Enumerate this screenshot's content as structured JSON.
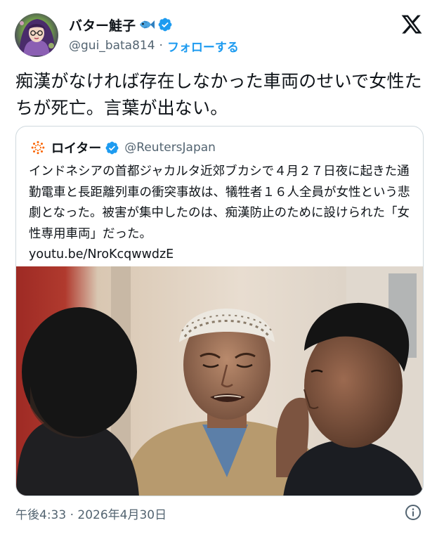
{
  "author": {
    "display_name": "バター鮭子",
    "name_icons": [
      "fish-icon",
      "verified-icon"
    ],
    "handle": "@gui_bata814",
    "separator": "·",
    "follow_label": "フォローする"
  },
  "platform_logo": "x-logo",
  "tweet": {
    "text": "痴漢がなければ存在しなかった車両のせいで女性たちが死亡。言葉が出ない。"
  },
  "quote": {
    "name": "ロイター",
    "handle": "@ReutersJapan",
    "text": "インドネシアの首都ジャカルタ近郊ブカシで４月２７日夜に起きた通勤電車と長距離列車の衝突事故は、犠牲者１６人全員が女性という悲劇となった。被害が集中したのは、痴漢防止のために設けられた「女性専用車両」だった。",
    "link": "youtu.be/NroKcqwwdzE"
  },
  "timestamp": {
    "time": "午後4:33",
    "separator": "·",
    "date": "2026年4月30日"
  },
  "colors": {
    "link_blue": "#1d9bf0",
    "secondary_text": "#536471",
    "border": "#cfd9de",
    "reuters_orange": "#fa6400"
  }
}
